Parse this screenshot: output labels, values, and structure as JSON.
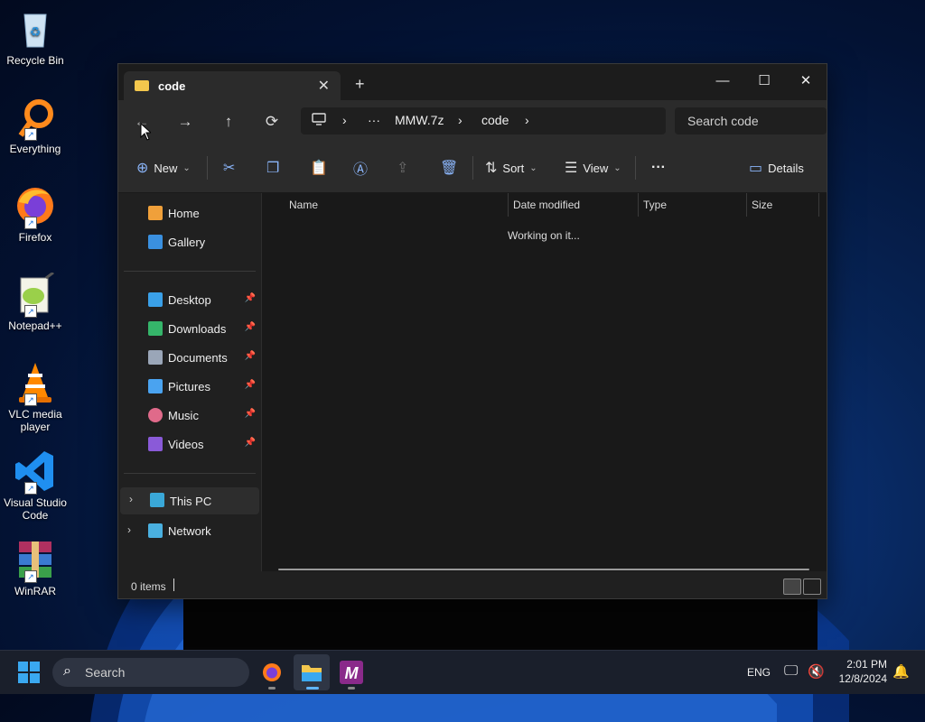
{
  "desktop": {
    "icons": [
      {
        "label": "Recycle Bin"
      },
      {
        "label": "Everything"
      },
      {
        "label": "Firefox"
      },
      {
        "label": "Notepad++"
      },
      {
        "label": "VLC media player"
      },
      {
        "label": "Visual Studio Code"
      },
      {
        "label": "WinRAR"
      }
    ]
  },
  "window": {
    "tab_title": "code",
    "close_tab": "✕",
    "new_tab": "+",
    "controls": {
      "minimize": "—",
      "maximize": "☐",
      "close": "✕"
    }
  },
  "navigation": {
    "back": "←",
    "forward": "→",
    "up": "↑",
    "refresh": "⟳",
    "breadcrumb": {
      "more": "···",
      "items": [
        "MMW.7z",
        "code"
      ],
      "sep": "›"
    },
    "search_placeholder": "Search code"
  },
  "toolbar": {
    "new_label": "New",
    "sort_label": "Sort",
    "view_label": "View",
    "more_label": "···",
    "details_label": "Details"
  },
  "sidebar": {
    "home": "Home",
    "gallery": "Gallery",
    "pinned": [
      {
        "label": "Desktop",
        "color": "#3aa0e8"
      },
      {
        "label": "Downloads",
        "color": "#35b56a"
      },
      {
        "label": "Documents",
        "color": "#9aa6b8"
      },
      {
        "label": "Pictures",
        "color": "#4aa3f0"
      },
      {
        "label": "Music",
        "color": "#e06a8a"
      },
      {
        "label": "Videos",
        "color": "#8a5ad8"
      }
    ],
    "this_pc": "This PC",
    "network": "Network"
  },
  "columns": [
    "Name",
    "Date modified",
    "Type",
    "Size"
  ],
  "content": {
    "status": "Working on it..."
  },
  "statusbar": {
    "item_count": "0 items"
  },
  "taskbar": {
    "search_label": "Search",
    "language": "ENG",
    "time": "2:01 PM",
    "date": "12/8/2024"
  },
  "colors": {
    "accent": "#60b4ff",
    "folder": "#f3c74d",
    "window_bg": "#202020",
    "taskbar_bg": "#1a1f2b"
  }
}
